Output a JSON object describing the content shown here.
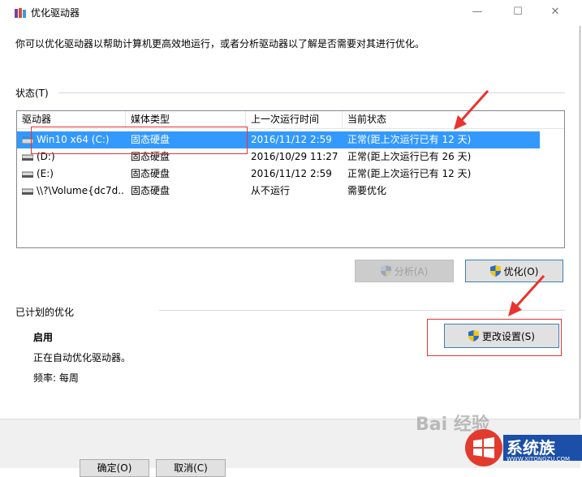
{
  "window": {
    "title": "优化驱动器",
    "minimize": "—",
    "maximize": "☐",
    "close": "✕"
  },
  "description": "你可以优化驱动器以帮助计算机更高效地运行，或者分析驱动器以了解是否需要对其进行优化。",
  "status": {
    "label": "状态(T)",
    "columns": [
      "驱动器",
      "媒体类型",
      "上一次运行时间",
      "当前状态"
    ],
    "rows": [
      {
        "drive": "Win10 x64 (C:)",
        "media": "固态硬盘",
        "last_run": "2016/11/12 2:59",
        "state": "正常(距上次运行已有 12 天)",
        "selected": true
      },
      {
        "drive": "(D:)",
        "media": "固态硬盘",
        "last_run": "2016/10/29 11:27",
        "state": "正常(距上次运行已有 26 天)",
        "selected": false
      },
      {
        "drive": "(E:)",
        "media": "固态硬盘",
        "last_run": "2016/11/12 2:59",
        "state": "正常(距上次运行已有 12 天)",
        "selected": false
      },
      {
        "drive": "\\\\?\\Volume{dc7d...",
        "media": "固态硬盘",
        "last_run": "从不运行",
        "state": "需要优化",
        "selected": false
      }
    ]
  },
  "buttons": {
    "analyze": "分析(A)",
    "optimize": "优化(O)",
    "change_settings": "更改设置(S)"
  },
  "scheduled": {
    "label": "已计划的优化",
    "state": "启用",
    "detail": "正在自动优化驱动器。",
    "frequency": "频率: 每周"
  },
  "footer": {
    "ok": "确定(O)",
    "cancel": "取消(C)"
  },
  "watermark": {
    "text": "Bai 经验",
    "logo_text": "系统族",
    "logo_url": "WWW.XITONGZU.COM"
  },
  "colors": {
    "selection": "#3399ff",
    "annotation": "#e8332f",
    "shield_blue": "#2b6cc4",
    "shield_yellow": "#f2c811"
  }
}
